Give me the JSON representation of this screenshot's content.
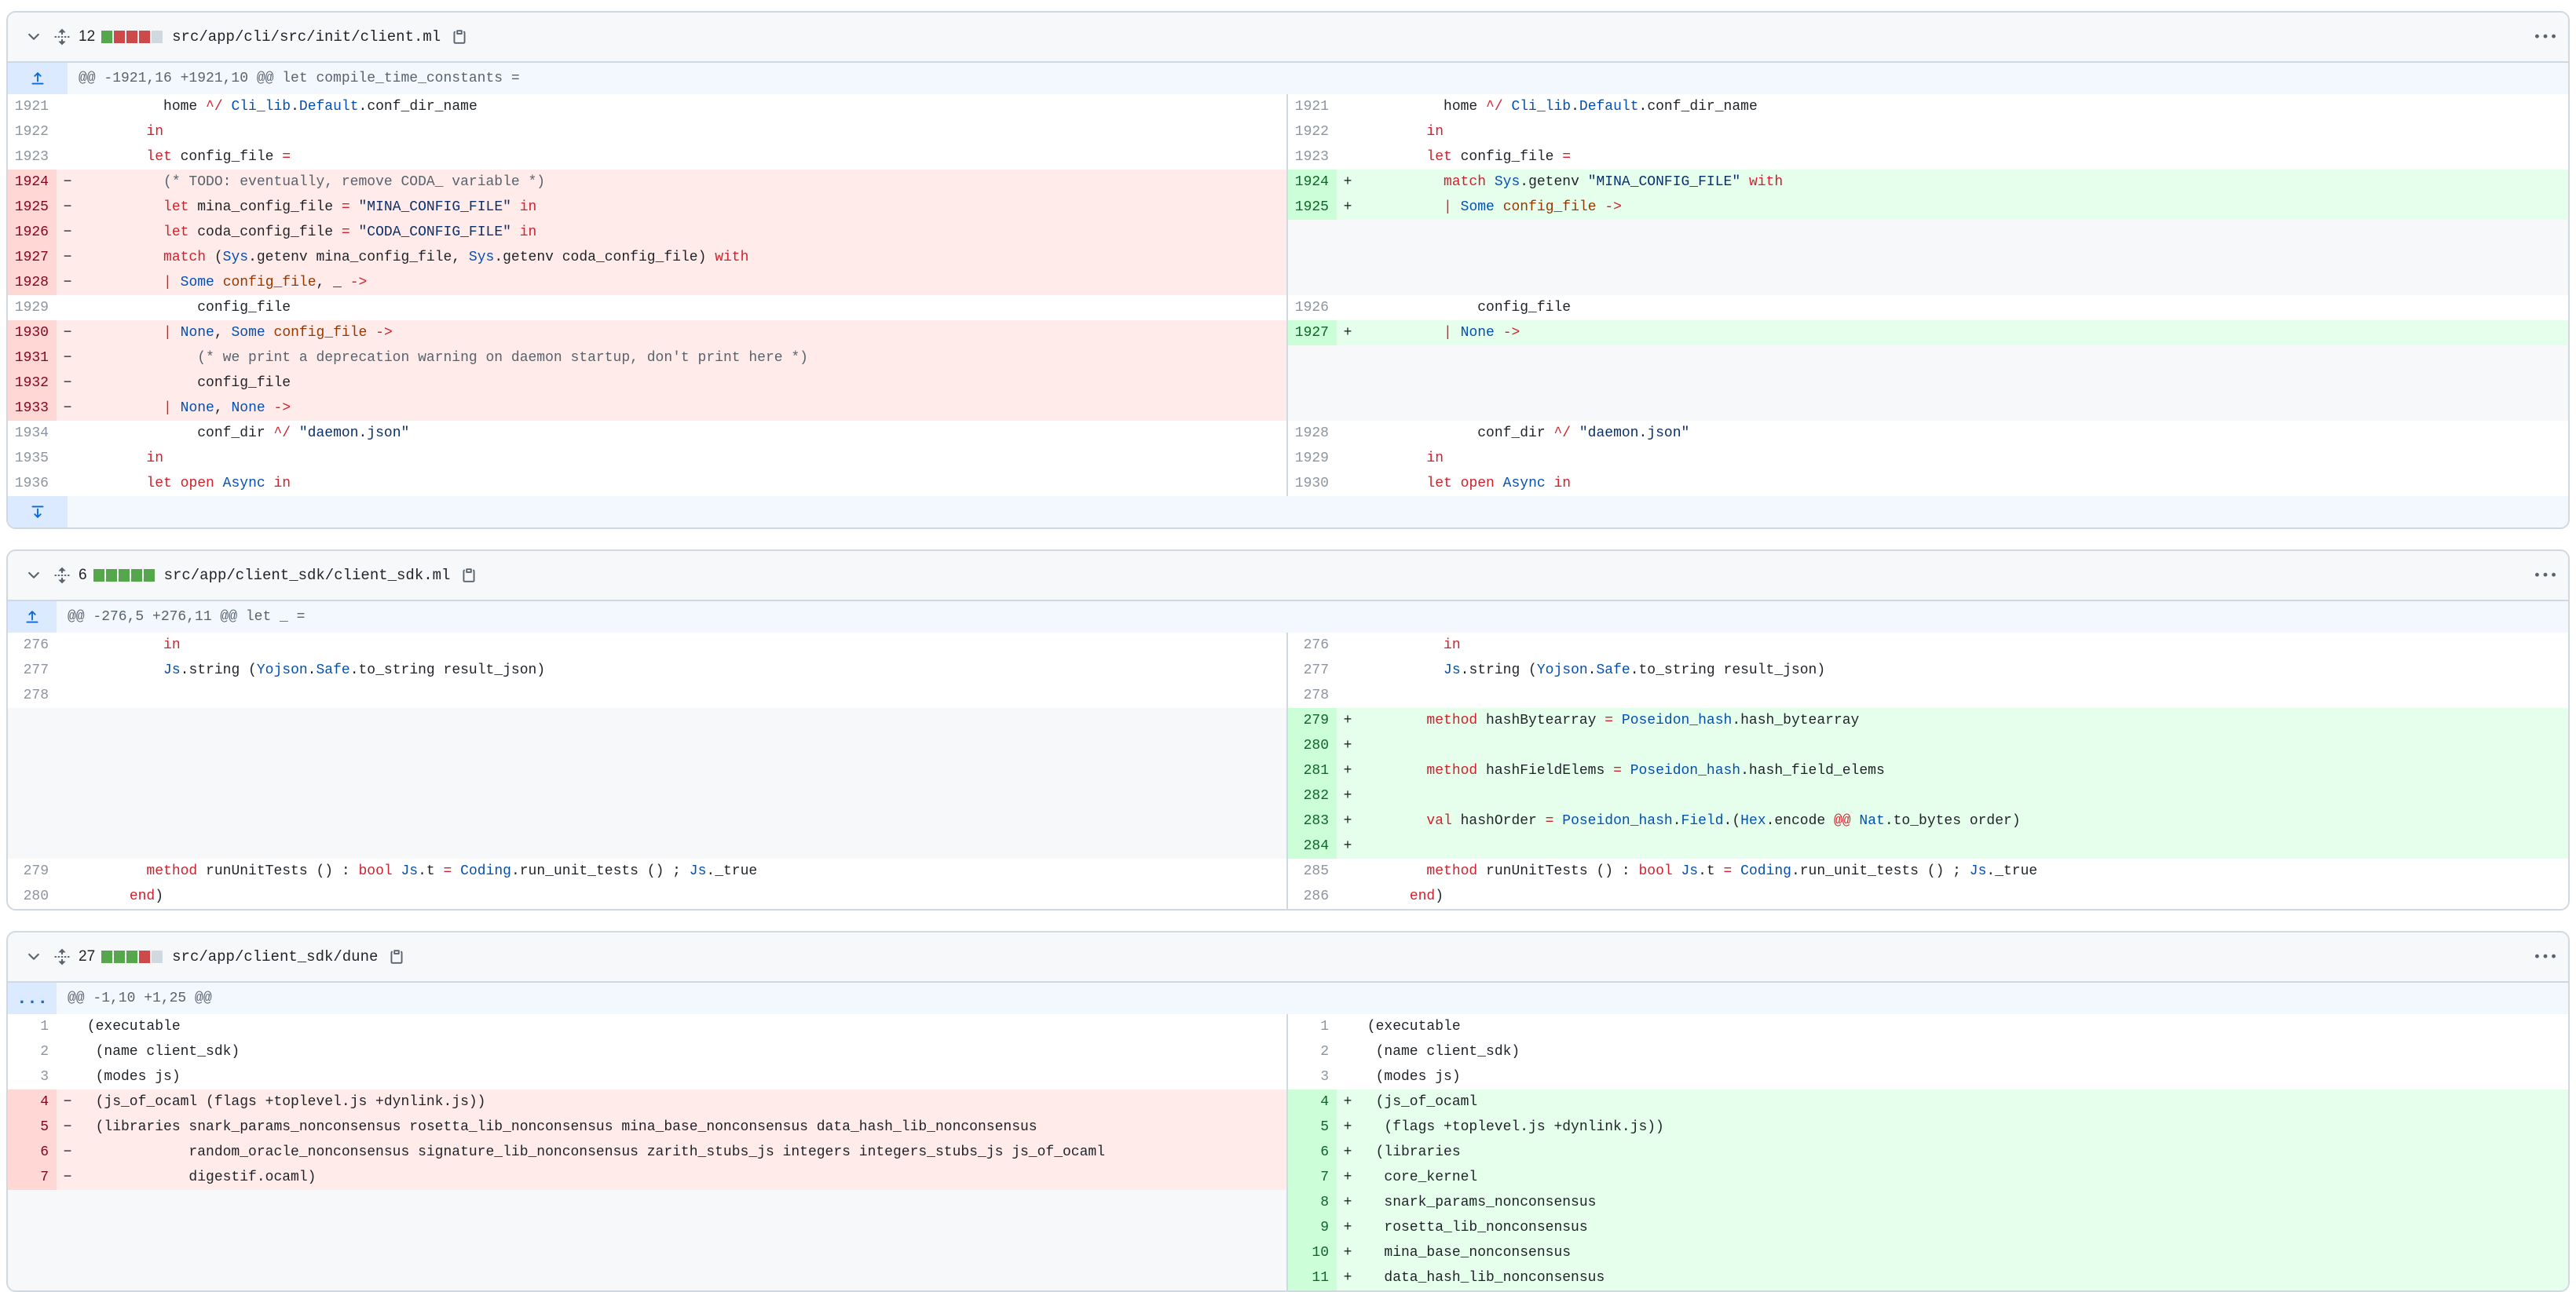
{
  "files": [
    {
      "count": "12",
      "path": "src/app/cli/src/init/client.ml",
      "stat": [
        "g",
        "r",
        "r",
        "r",
        "n"
      ],
      "hunk": "@@ -1921,16 +1921,10 @@ let compile_time_constants =",
      "rows": [
        {
          "l": {
            "t": "ctx",
            "n": "1921",
            "c": "          home ^/ Cli_lib.Default.conf_dir_name"
          },
          "r": {
            "t": "ctx",
            "n": "1921",
            "c": "          home ^/ Cli_lib.Default.conf_dir_name"
          }
        },
        {
          "l": {
            "t": "ctx",
            "n": "1922",
            "c": "        in"
          },
          "r": {
            "t": "ctx",
            "n": "1922",
            "c": "        in"
          }
        },
        {
          "l": {
            "t": "ctx",
            "n": "1923",
            "c": "        let config_file ="
          },
          "r": {
            "t": "ctx",
            "n": "1923",
            "c": "        let config_file ="
          }
        },
        {
          "l": {
            "t": "del",
            "n": "1924",
            "c": "          (* TODO: eventually, remove CODA_ variable *)"
          },
          "r": {
            "t": "add",
            "n": "1924",
            "c": "          match Sys.getenv \"MINA_CONFIG_FILE\" with"
          }
        },
        {
          "l": {
            "t": "del",
            "n": "1925",
            "c": "          let mina_config_file = \"MINA_CONFIG_FILE\" in"
          },
          "r": {
            "t": "add",
            "n": "1925",
            "c": "          | Some config_file ->"
          }
        },
        {
          "l": {
            "t": "del",
            "n": "1926",
            "c": "          let coda_config_file = \"CODA_CONFIG_FILE\" in"
          },
          "r": {
            "t": "empty"
          }
        },
        {
          "l": {
            "t": "del",
            "n": "1927",
            "c": "          match (Sys.getenv mina_config_file, Sys.getenv coda_config_file) with"
          },
          "r": {
            "t": "empty"
          }
        },
        {
          "l": {
            "t": "del",
            "n": "1928",
            "c": "          | Some config_file, _ ->"
          },
          "r": {
            "t": "empty"
          }
        },
        {
          "l": {
            "t": "ctx",
            "n": "1929",
            "c": "              config_file"
          },
          "r": {
            "t": "ctx",
            "n": "1926",
            "c": "              config_file"
          }
        },
        {
          "l": {
            "t": "del",
            "n": "1930",
            "c": "          | None, Some config_file ->"
          },
          "r": {
            "t": "add",
            "n": "1927",
            "c": "          | None ->"
          }
        },
        {
          "l": {
            "t": "del",
            "n": "1931",
            "c": "              (* we print a deprecation warning on daemon startup, don't print here *)"
          },
          "r": {
            "t": "empty"
          }
        },
        {
          "l": {
            "t": "del",
            "n": "1932",
            "c": "              config_file"
          },
          "r": {
            "t": "empty"
          }
        },
        {
          "l": {
            "t": "del",
            "n": "1933",
            "c": "          | None, None ->"
          },
          "r": {
            "t": "empty"
          }
        },
        {
          "l": {
            "t": "ctx",
            "n": "1934",
            "c": "              conf_dir ^/ \"daemon.json\""
          },
          "r": {
            "t": "ctx",
            "n": "1928",
            "c": "              conf_dir ^/ \"daemon.json\""
          }
        },
        {
          "l": {
            "t": "ctx",
            "n": "1935",
            "c": "        in"
          },
          "r": {
            "t": "ctx",
            "n": "1929",
            "c": "        in"
          }
        },
        {
          "l": {
            "t": "ctx",
            "n": "1936",
            "c": "        let open Async in"
          },
          "r": {
            "t": "ctx",
            "n": "1930",
            "c": "        let open Async in"
          }
        }
      ],
      "footer_expand": true
    },
    {
      "count": "6",
      "path": "src/app/client_sdk/client_sdk.ml",
      "stat": [
        "g",
        "g",
        "g",
        "g",
        "g"
      ],
      "hunk": "@@ -276,5 +276,11 @@ let _ =",
      "rows": [
        {
          "l": {
            "t": "ctx",
            "n": "276",
            "c": "          in"
          },
          "r": {
            "t": "ctx",
            "n": "276",
            "c": "          in"
          }
        },
        {
          "l": {
            "t": "ctx",
            "n": "277",
            "c": "          Js.string (Yojson.Safe.to_string result_json)"
          },
          "r": {
            "t": "ctx",
            "n": "277",
            "c": "          Js.string (Yojson.Safe.to_string result_json)"
          }
        },
        {
          "l": {
            "t": "ctx",
            "n": "278",
            "c": ""
          },
          "r": {
            "t": "ctx",
            "n": "278",
            "c": ""
          }
        },
        {
          "l": {
            "t": "empty"
          },
          "r": {
            "t": "add",
            "n": "279",
            "c": "        method hashBytearray = Poseidon_hash.hash_bytearray"
          }
        },
        {
          "l": {
            "t": "empty"
          },
          "r": {
            "t": "add",
            "n": "280",
            "c": ""
          }
        },
        {
          "l": {
            "t": "empty"
          },
          "r": {
            "t": "add",
            "n": "281",
            "c": "        method hashFieldElems = Poseidon_hash.hash_field_elems"
          }
        },
        {
          "l": {
            "t": "empty"
          },
          "r": {
            "t": "add",
            "n": "282",
            "c": ""
          }
        },
        {
          "l": {
            "t": "empty"
          },
          "r": {
            "t": "add",
            "n": "283",
            "c": "        val hashOrder = Poseidon_hash.Field.(Hex.encode @@ Nat.to_bytes order)"
          }
        },
        {
          "l": {
            "t": "empty"
          },
          "r": {
            "t": "add",
            "n": "284",
            "c": ""
          }
        },
        {
          "l": {
            "t": "ctx",
            "n": "279",
            "c": "        method runUnitTests () : bool Js.t = Coding.run_unit_tests () ; Js._true"
          },
          "r": {
            "t": "ctx",
            "n": "285",
            "c": "        method runUnitTests () : bool Js.t = Coding.run_unit_tests () ; Js._true"
          }
        },
        {
          "l": {
            "t": "ctx",
            "n": "280",
            "c": "      end)"
          },
          "r": {
            "t": "ctx",
            "n": "286",
            "c": "      end)"
          }
        }
      ],
      "footer_expand": false
    },
    {
      "count": "27",
      "path": "src/app/client_sdk/dune",
      "stat": [
        "g",
        "g",
        "g",
        "r",
        "n"
      ],
      "hunk": "@@ -1,10 +1,25 @@",
      "hunk_button": "...",
      "rows": [
        {
          "l": {
            "t": "ctx",
            "n": "1",
            "c": " (executable"
          },
          "r": {
            "t": "ctx",
            "n": "1",
            "c": " (executable"
          }
        },
        {
          "l": {
            "t": "ctx",
            "n": "2",
            "c": "  (name client_sdk)"
          },
          "r": {
            "t": "ctx",
            "n": "2",
            "c": "  (name client_sdk)"
          }
        },
        {
          "l": {
            "t": "ctx",
            "n": "3",
            "c": "  (modes js)"
          },
          "r": {
            "t": "ctx",
            "n": "3",
            "c": "  (modes js)"
          }
        },
        {
          "l": {
            "t": "del",
            "n": "4",
            "c": "  (js_of_ocaml (flags +toplevel.js +dynlink.js))"
          },
          "r": {
            "t": "add",
            "n": "4",
            "c": "  (js_of_ocaml"
          }
        },
        {
          "l": {
            "t": "del",
            "n": "5",
            "c": "  (libraries snark_params_nonconsensus rosetta_lib_nonconsensus mina_base_nonconsensus data_hash_lib_nonconsensus"
          },
          "r": {
            "t": "add",
            "n": "5",
            "c": "   (flags +toplevel.js +dynlink.js))"
          }
        },
        {
          "l": {
            "t": "del",
            "n": "6",
            "c": "             random_oracle_nonconsensus signature_lib_nonconsensus zarith_stubs_js integers integers_stubs_js js_of_ocaml"
          },
          "r": {
            "t": "add",
            "n": "6",
            "c": "  (libraries"
          }
        },
        {
          "l": {
            "t": "del",
            "n": "7",
            "c": "             digestif.ocaml)"
          },
          "r": {
            "t": "add",
            "n": "7",
            "c": "   core_kernel"
          }
        },
        {
          "l": {
            "t": "empty"
          },
          "r": {
            "t": "add",
            "n": "8",
            "c": "   snark_params_nonconsensus"
          }
        },
        {
          "l": {
            "t": "empty"
          },
          "r": {
            "t": "add",
            "n": "9",
            "c": "   rosetta_lib_nonconsensus"
          }
        },
        {
          "l": {
            "t": "empty"
          },
          "r": {
            "t": "add",
            "n": "10",
            "c": "   mina_base_nonconsensus"
          }
        },
        {
          "l": {
            "t": "empty"
          },
          "r": {
            "t": "add",
            "n": "11",
            "c": "   data_hash_lib_nonconsensus"
          }
        }
      ],
      "footer_expand": false
    }
  ],
  "colors": {
    "addBg": "#e6ffec",
    "addNum": "#ccffd8",
    "delBg": "#ffebe9",
    "delNum": "#ffd7d5",
    "keyword": "#cf222e",
    "module": "#0550ae",
    "string": "#0a3069"
  },
  "icons": [
    "chevron-down-icon",
    "unfold-icon",
    "copy-icon",
    "kebab-icon",
    "expand-up-icon",
    "expand-down-icon"
  ]
}
